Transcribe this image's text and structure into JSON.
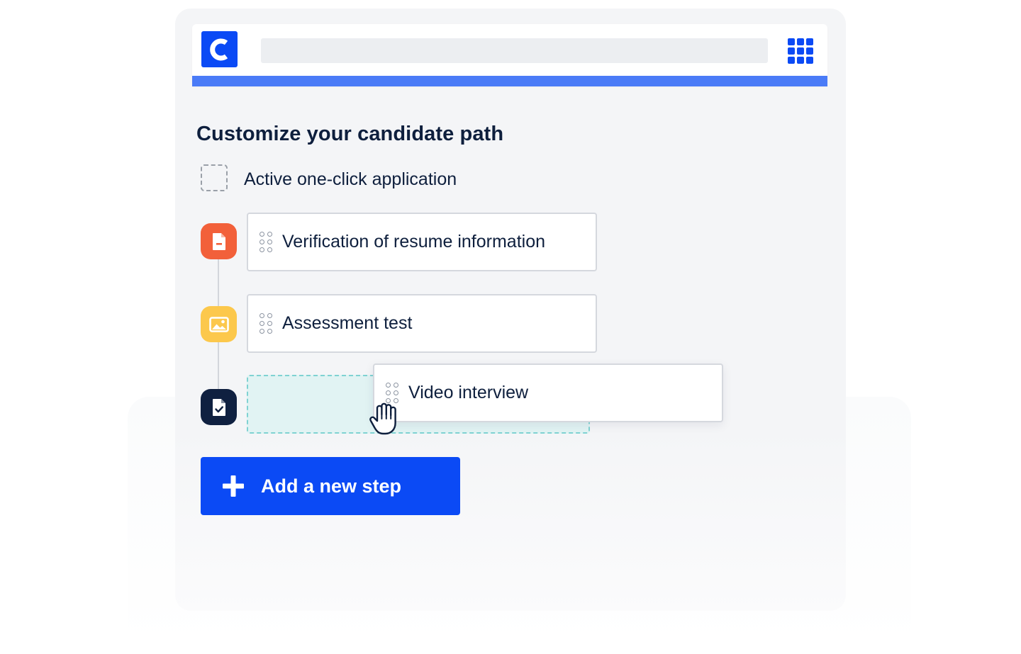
{
  "header": {
    "logo_letter": "C",
    "brand_color": "#0b4af5",
    "accent_stripe_color": "#4a7bf7",
    "apps_icon": "grid-apps-icon"
  },
  "page": {
    "title": "Customize your candidate path"
  },
  "option": {
    "label": "Active one-click application",
    "checked": false
  },
  "steps": [
    {
      "label": "Verification of resume information",
      "icon": "document-icon",
      "icon_color": "#f2603a"
    },
    {
      "label": "Assessment test",
      "icon": "image-icon",
      "icon_color": "#fcc84c"
    },
    {
      "label": "Video interview",
      "icon": "checked-document-icon",
      "icon_color": "#0f2040",
      "state": "dragging"
    }
  ],
  "actions": {
    "add_step_label": "Add a new step"
  }
}
